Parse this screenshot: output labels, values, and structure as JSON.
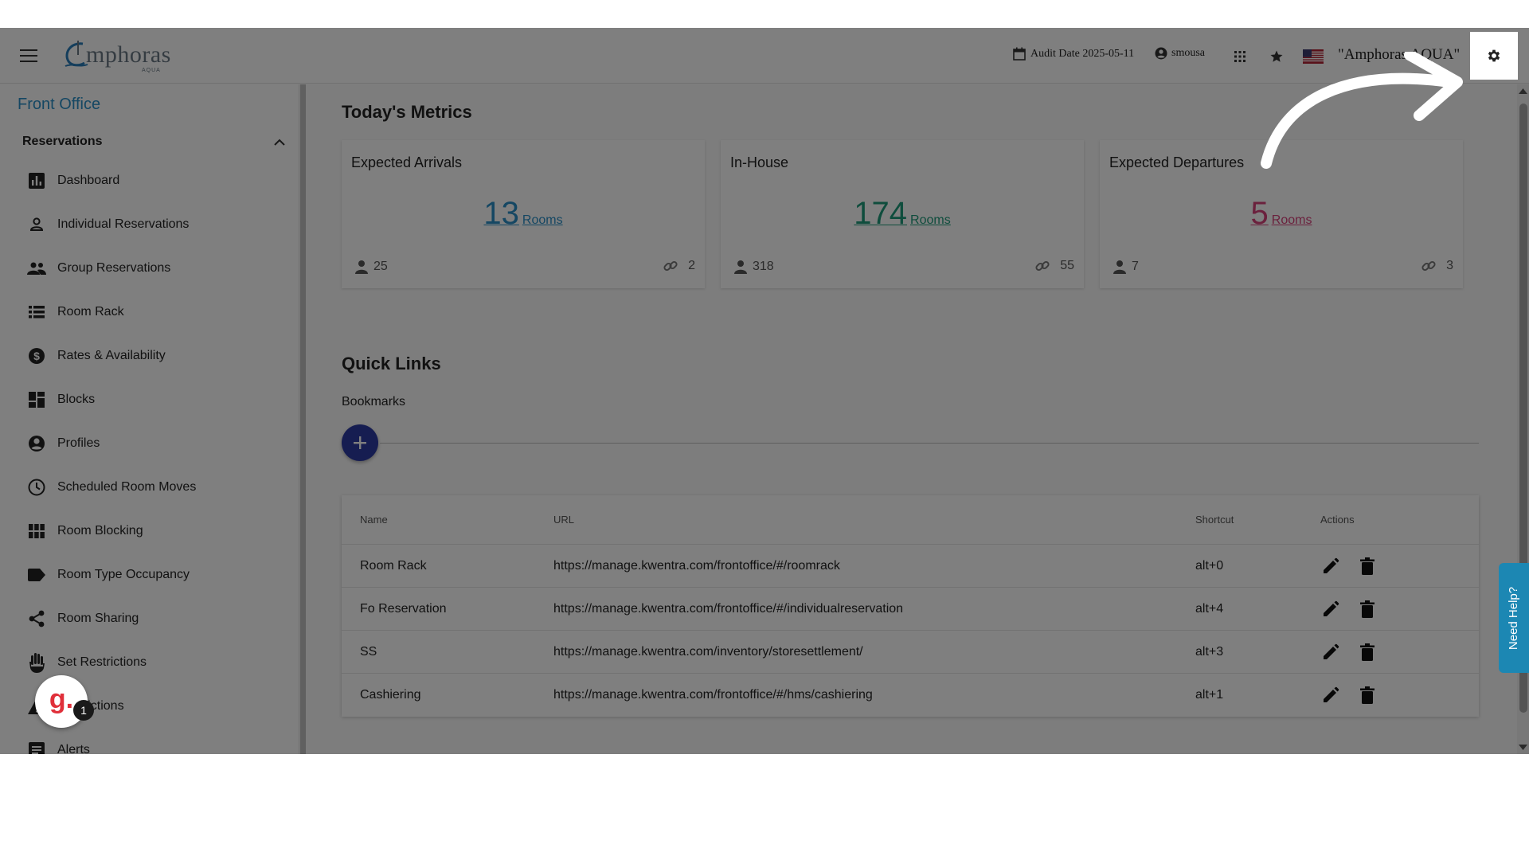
{
  "header": {
    "logo_text": "mphoras",
    "logo_sub": "AQUA",
    "audit_label": "Audit Date 2025-05-11",
    "username": "smousa",
    "hotel_name": "\"Amphoras AQUA\""
  },
  "sidebar": {
    "section_title": "Front Office",
    "group_label": "Reservations",
    "items": [
      {
        "label": "Dashboard"
      },
      {
        "label": "Individual Reservations"
      },
      {
        "label": "Group Reservations"
      },
      {
        "label": "Room Rack"
      },
      {
        "label": "Rates & Availability"
      },
      {
        "label": "Blocks"
      },
      {
        "label": "Profiles"
      },
      {
        "label": "Scheduled Room Moves"
      },
      {
        "label": "Room Blocking"
      },
      {
        "label": "Room Type Occupancy"
      },
      {
        "label": "Room Sharing"
      },
      {
        "label": "Set Restrictions"
      },
      {
        "label": "Restrictions"
      },
      {
        "label": "Alerts"
      }
    ]
  },
  "metrics": {
    "title": "Today's Metrics",
    "cards": [
      {
        "title": "Expected Arrivals",
        "value": "13",
        "unit": "Rooms",
        "persons": "25",
        "links": "2",
        "color": "#2a8fc6"
      },
      {
        "title": "In-House",
        "value": "174",
        "unit": "Rooms",
        "persons": "318",
        "links": "55",
        "color": "#1f9a7a"
      },
      {
        "title": "Expected Departures",
        "value": "5",
        "unit": "Rooms",
        "persons": "7",
        "links": "3",
        "color": "#d6427a"
      }
    ]
  },
  "quicklinks": {
    "title": "Quick Links",
    "bookmarks_label": "Bookmarks",
    "table": {
      "headers": {
        "name": "Name",
        "url": "URL",
        "shortcut": "Shortcut",
        "actions": "Actions"
      },
      "rows": [
        {
          "name": "Room Rack",
          "url": "https://manage.kwentra.com/frontoffice/#/roomrack",
          "shortcut": "alt+0"
        },
        {
          "name": "Fo Reservation",
          "url": "https://manage.kwentra.com/frontoffice/#/individualreservation",
          "shortcut": "alt+4"
        },
        {
          "name": "SS",
          "url": "https://manage.kwentra.com/inventory/storesettlement/",
          "shortcut": "alt+3"
        },
        {
          "name": "Cashiering",
          "url": "https://manage.kwentra.com/frontoffice/#/hms/cashiering",
          "shortcut": "alt+1"
        }
      ]
    }
  },
  "help": {
    "label": "Need Help?"
  },
  "notification": {
    "letter": "g.",
    "count": "1"
  }
}
